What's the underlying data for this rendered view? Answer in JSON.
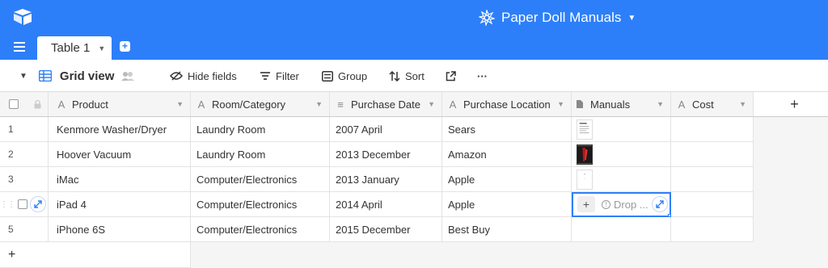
{
  "base": {
    "title": "Paper Doll Manuals"
  },
  "tabs": [
    {
      "label": "Table 1",
      "active": true
    }
  ],
  "viewbar": {
    "view_name": "Grid view",
    "hide_fields": "Hide fields",
    "filter": "Filter",
    "group": "Group",
    "sort": "Sort",
    "more": "···"
  },
  "columns": [
    {
      "name": "Product",
      "type_icon": "A"
    },
    {
      "name": "Room/Category",
      "type_icon": "A"
    },
    {
      "name": "Purchase Date",
      "type_icon": "≡"
    },
    {
      "name": "Purchase Location",
      "type_icon": "A"
    },
    {
      "name": "Manuals",
      "type_icon": "doc"
    },
    {
      "name": "Cost",
      "type_icon": "A"
    }
  ],
  "add_column_label": "+",
  "rows": [
    {
      "num": "1",
      "product": "Kenmore Washer/Dryer",
      "room": "Laundry Room",
      "date": "2007 April",
      "location": "Sears",
      "manual": "doc-thumbnail"
    },
    {
      "num": "2",
      "product": "Hoover Vacuum",
      "room": "Laundry Room",
      "date": "2013 December",
      "location": "Amazon",
      "manual": "photo-thumbnail"
    },
    {
      "num": "3",
      "product": "iMac",
      "room": "Computer/Electronics",
      "date": "2013 January",
      "location": "Apple",
      "manual": "blank-thumbnail"
    },
    {
      "num": "",
      "product": "iPad 4",
      "room": "Computer/Electronics",
      "date": "2014 April",
      "location": "Apple",
      "manual": "drop"
    },
    {
      "num": "5",
      "product": "iPhone 6S",
      "room": "Computer/Electronics",
      "date": "2015 December",
      "location": "Best Buy",
      "manual": ""
    }
  ],
  "drop_label": "Drop ...",
  "add_row_label": "+",
  "colors": {
    "accent": "#2d7ff9",
    "header_bg": "#f5f5f5"
  }
}
